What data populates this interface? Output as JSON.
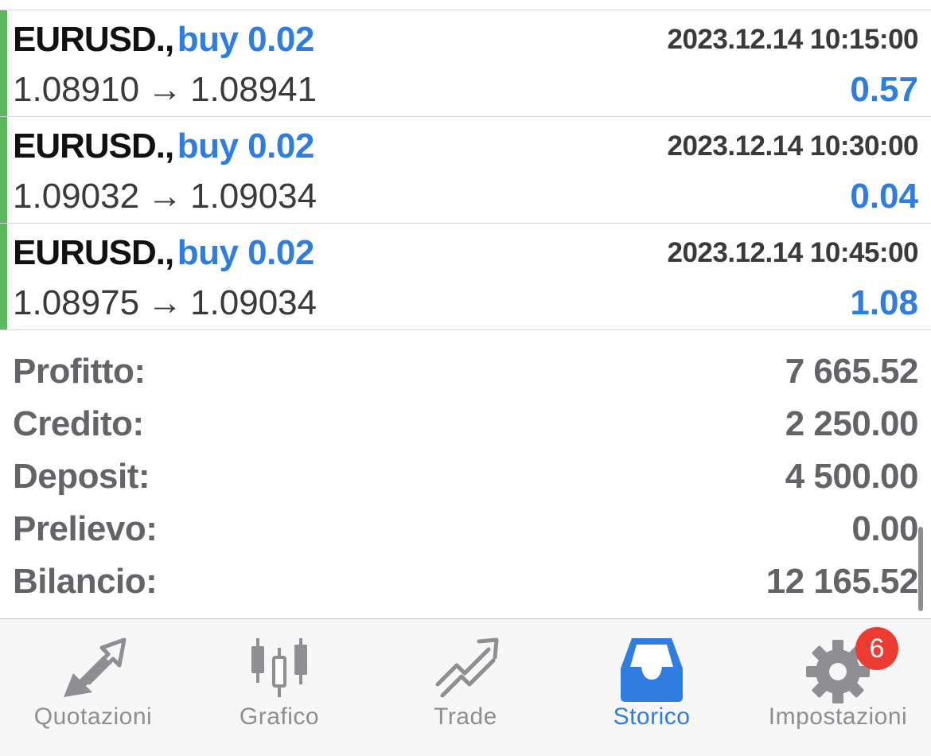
{
  "trades": [
    {
      "symbol": "EURUSD.,",
      "side": "buy 0.02",
      "time": "2023.12.14 10:15:00",
      "open_price": "1.08910",
      "arrow": "→",
      "close_price": "1.08941",
      "profit": "0.57"
    },
    {
      "symbol": "EURUSD.,",
      "side": "buy 0.02",
      "time": "2023.12.14 10:30:00",
      "open_price": "1.09032",
      "arrow": "→",
      "close_price": "1.09034",
      "profit": "0.04"
    },
    {
      "symbol": "EURUSD.,",
      "side": "buy 0.02",
      "time": "2023.12.14 10:45:00",
      "open_price": "1.08975",
      "arrow": "→",
      "close_price": "1.09034",
      "profit": "1.08"
    }
  ],
  "summary": [
    {
      "label": "Profitto:",
      "value": "7 665.52"
    },
    {
      "label": "Credito:",
      "value": "2 250.00"
    },
    {
      "label": "Deposit:",
      "value": "4 500.00"
    },
    {
      "label": "Prelievo:",
      "value": "0.00"
    },
    {
      "label": "Bilancio:",
      "value": "12 165.52"
    }
  ],
  "tabbar": {
    "tabs": [
      {
        "label": "Quotazioni",
        "icon": "quotes-arrows-icon",
        "active": false
      },
      {
        "label": "Grafico",
        "icon": "candlestick-chart-icon",
        "active": false
      },
      {
        "label": "Trade",
        "icon": "trade-trend-icon",
        "active": false
      },
      {
        "label": "Storico",
        "icon": "history-inbox-icon",
        "active": true
      },
      {
        "label": "Impostazioni",
        "icon": "gear-icon",
        "active": false
      }
    ],
    "settings_badge": "6"
  },
  "colors": {
    "accent": "#2f7de1",
    "profit_bar": "#5cb85c",
    "badge": "#ec3c32",
    "inactive_icon": "#8e8e93"
  }
}
